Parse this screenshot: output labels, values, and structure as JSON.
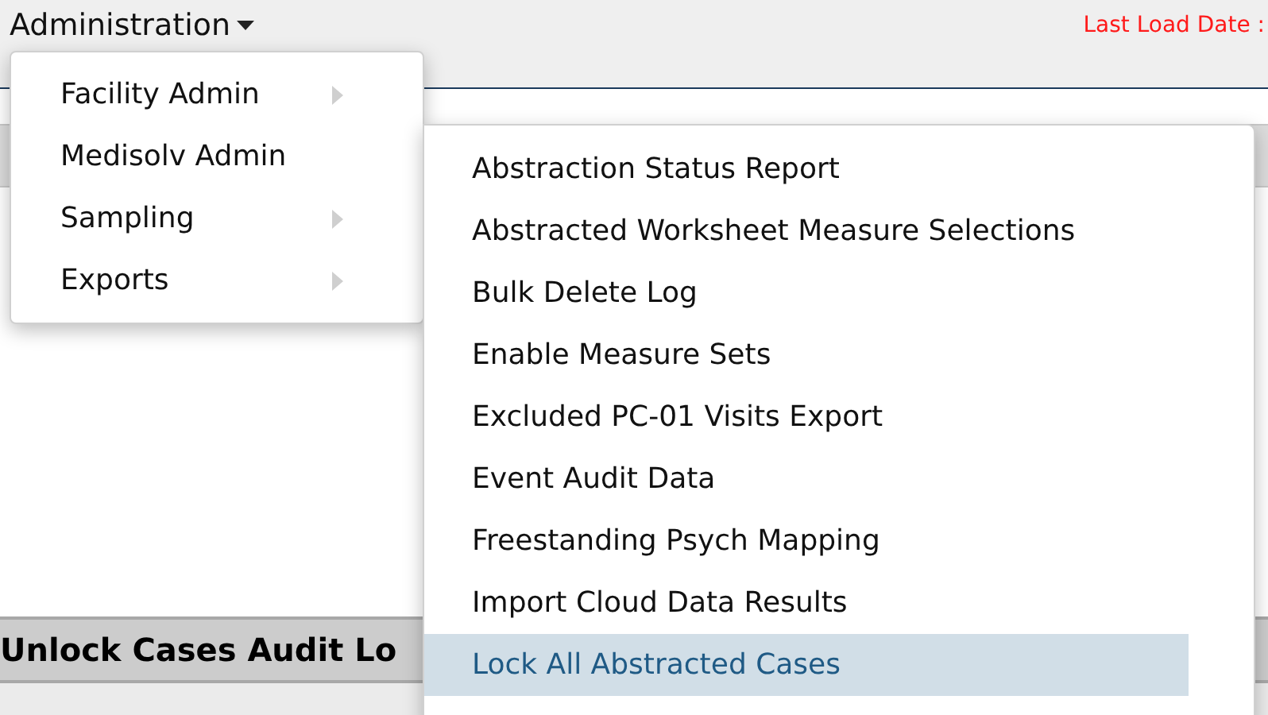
{
  "header": {
    "menu_title": "Administration",
    "last_load_label": "Last Load Date :"
  },
  "admin_menu": [
    {
      "label": "Facility Admin",
      "has_submenu": true
    },
    {
      "label": "Medisolv Admin",
      "has_submenu": false
    },
    {
      "label": "Sampling",
      "has_submenu": true
    },
    {
      "label": "Exports",
      "has_submenu": true
    }
  ],
  "submenu": [
    {
      "label": "Abstraction Status Report",
      "selected": false
    },
    {
      "label": "Abstracted Worksheet Measure Selections",
      "selected": false
    },
    {
      "label": "Bulk Delete Log",
      "selected": false
    },
    {
      "label": "Enable Measure Sets",
      "selected": false
    },
    {
      "label": "Excluded PC-01 Visits Export",
      "selected": false
    },
    {
      "label": "Event Audit Data",
      "selected": false
    },
    {
      "label": "Freestanding Psych Mapping",
      "selected": false
    },
    {
      "label": "Import Cloud Data Results",
      "selected": false
    },
    {
      "label": "Lock All Abstracted Cases",
      "selected": true
    }
  ],
  "section_title": "Unlock Cases Audit Lo"
}
